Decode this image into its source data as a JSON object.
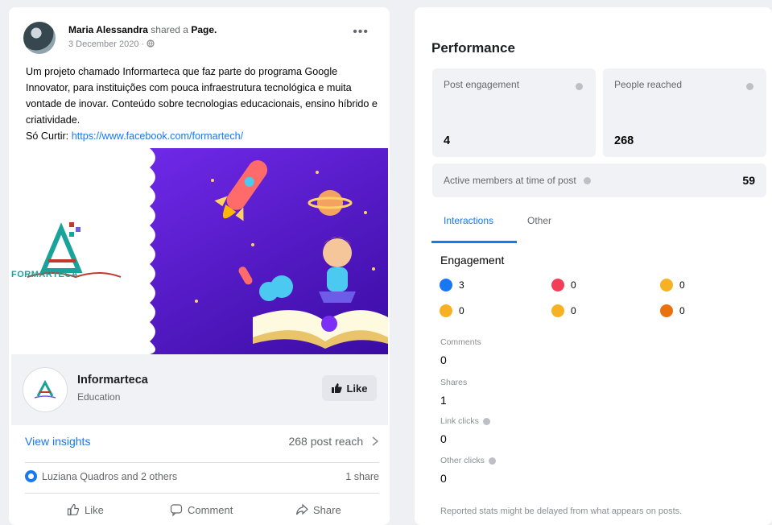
{
  "post": {
    "author": "Maria Alessandra",
    "shared_text": "shared a",
    "shared_target": "Page.",
    "date": "3 December 2020 ·",
    "more": "•••",
    "body": "Um projeto chamado Informarteca que faz parte do programa Google Innovator, para instituições com pouca infraestrutura tecnológica e muita vontade de inovar. Conteúdo sobre tecnologias educacionais, ensino híbrido e criatividade.",
    "link_prefix": "Só Curtir: ",
    "link_text": "https://www.facebook.com/formartech/",
    "image_logo_text": "FORMARTECA",
    "page": {
      "name": "Informarteca",
      "category": "Education",
      "like_label": "Like"
    },
    "view_insights": "View insights",
    "post_reach": "268 post reach",
    "reactors": "Luziana Quadros and 2 others",
    "shares": "1 share",
    "actions": {
      "like": "Like",
      "comment": "Comment",
      "share": "Share"
    }
  },
  "performance": {
    "title": "Performance",
    "post_engagement_label": "Post engagement",
    "post_engagement_value": "4",
    "people_reached_label": "People reached",
    "people_reached_value": "268",
    "active_members_label": "Active members at time of post",
    "active_members_value": "59",
    "tabs": [
      "Interactions",
      "Other"
    ],
    "engagement_title": "Engagement",
    "reactions": [
      {
        "name": "like",
        "count": "3",
        "color": "#1877f2"
      },
      {
        "name": "love",
        "count": "0",
        "color": "#f33e58"
      },
      {
        "name": "haha",
        "count": "0",
        "color": "#f7b125"
      },
      {
        "name": "wow",
        "count": "0",
        "color": "#f7b125"
      },
      {
        "name": "sad",
        "count": "0",
        "color": "#f7b125"
      },
      {
        "name": "angry",
        "count": "0",
        "color": "#e9710f"
      }
    ],
    "metrics": [
      {
        "label": "Comments",
        "value": "0",
        "info": false
      },
      {
        "label": "Shares",
        "value": "1",
        "info": false
      },
      {
        "label": "Link clicks",
        "value": "0",
        "info": true
      },
      {
        "label": "Other clicks",
        "value": "0",
        "info": true
      }
    ],
    "footnote": "Reported stats might be delayed from what appears on posts."
  }
}
